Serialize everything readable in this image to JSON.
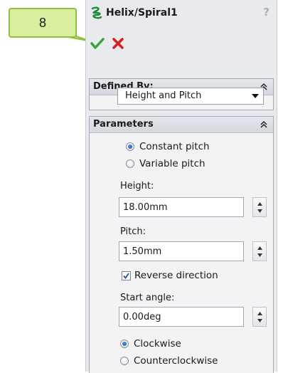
{
  "callout": {
    "number": "8"
  },
  "panel": {
    "title": "Helix/Spiral1",
    "help_label": "?"
  },
  "defined_by": {
    "header": "Defined By:",
    "selected": "Height and Pitch"
  },
  "parameters": {
    "header": "Parameters",
    "pitch_mode": [
      {
        "label": "Constant pitch",
        "selected": true
      },
      {
        "label": "Variable pitch",
        "selected": false
      }
    ],
    "height": {
      "label": "Height:",
      "value": "18.00mm"
    },
    "pitch": {
      "label": "Pitch:",
      "value": "1.50mm"
    },
    "reverse_direction": {
      "label": "Reverse direction",
      "checked": true
    },
    "start_angle": {
      "label": "Start angle:",
      "value": "0.00deg"
    },
    "rotation": [
      {
        "label": "Clockwise",
        "selected": true
      },
      {
        "label": "Counterclockwise",
        "selected": false
      }
    ]
  },
  "colors": {
    "callout_fill": "#d8efa0",
    "callout_border": "#8fbf3f",
    "ok_green": "#3aa63a",
    "cancel_red": "#d42020",
    "helix_icon_green": "#1f8a3a",
    "radio_selected": "#2f6fd0"
  },
  "icons": {
    "title": "helix-icon",
    "help": "help-icon",
    "ok": "checkmark-icon",
    "cancel": "close-icon",
    "collapse": "double-chevron-up-icon",
    "dropdown": "chevron-down-icon",
    "spin_up": "spin-up-icon",
    "spin_down": "spin-down-icon"
  }
}
